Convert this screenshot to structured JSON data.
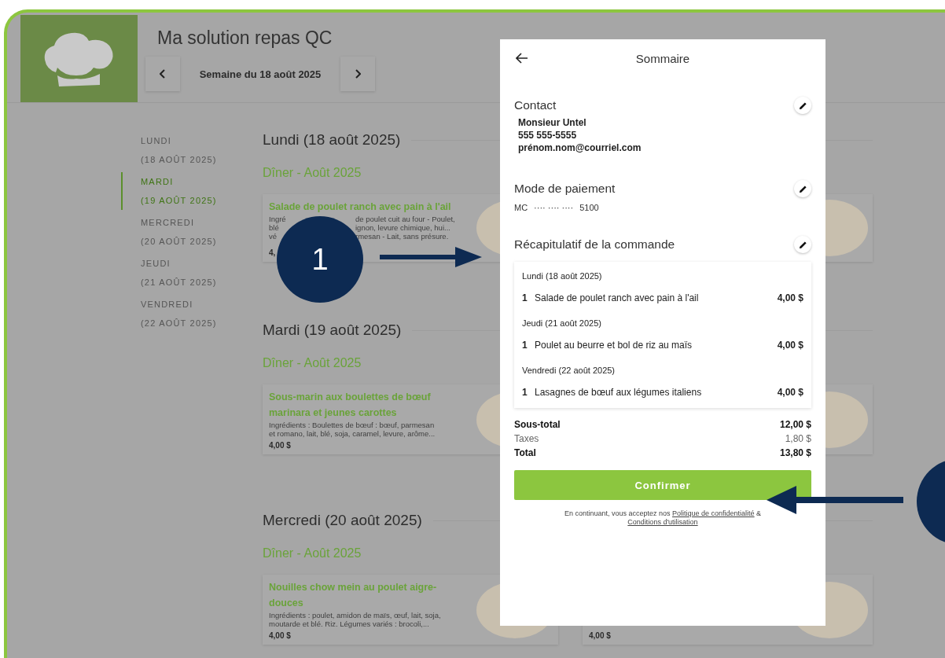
{
  "header": {
    "title": "Ma solution repas QC",
    "week_label": "Semaine du 18 août 2025"
  },
  "sidebar": {
    "items": [
      {
        "day": "LUNDI",
        "date": "(18 AOÛT 2025)",
        "selected": false
      },
      {
        "day": "MARDI",
        "date": "(19 AOÛT 2025)",
        "selected": true
      },
      {
        "day": "MERCREDI",
        "date": "(20 AOÛT 2025)",
        "selected": false
      },
      {
        "day": "JEUDI",
        "date": "(21 AOÛT 2025)",
        "selected": false
      },
      {
        "day": "VENDREDI",
        "date": "(22 AOÛT 2025)",
        "selected": false
      }
    ]
  },
  "days": [
    {
      "heading": "Lundi (18 août 2025)",
      "meal": "Dîner - Août 2025",
      "card": {
        "title": "Salade de poulet ranch avec pain à l'ail",
        "ingredient_lines": [
          [
            "Ingré",
            "de poulet cuit au four - Poulet,"
          ],
          [
            "blé",
            "ignon, levure chimique, hui..."
          ],
          [
            "vé",
            "rmesan - Lait, sans présure."
          ]
        ],
        "price": "4,"
      }
    },
    {
      "heading": "Mardi (19 août 2025)",
      "meal": "Dîner - Août 2025",
      "card": {
        "title": "Sous-marin aux boulettes de bœuf marinara et jeunes carottes",
        "ingredient_lines": [
          [
            "Ingrédients : Boulettes de bœuf : bœuf, parmesan"
          ],
          [
            "et romano, lait, blé, soja, caramel, levure, arôme..."
          ]
        ],
        "price": "4,00 $"
      }
    },
    {
      "heading": "Mercredi (20 août 2025)",
      "meal": "Dîner - Août 2025",
      "card": {
        "title": "Nouilles chow mein au poulet aigre-douces",
        "ingredient_lines": [
          [
            "Ingrédients : poulet, amidon de maïs, œuf, lait, soja,"
          ],
          [
            "moutarde et blé. Riz. Légumes variés : brocoli,..."
          ]
        ],
        "price": "4,00 $"
      },
      "side_card": {
        "price": "4,00 $"
      }
    }
  ],
  "summary": {
    "title": "Sommaire",
    "contact": {
      "heading": "Contact",
      "lines": [
        "Monsieur Untel",
        "555 555-5555",
        "prénom.nom@courriel.com"
      ]
    },
    "payment": {
      "heading": "Mode de paiement",
      "brand": "MC",
      "masked": "···· ···· ····",
      "last4": "5100"
    },
    "order": {
      "heading": "Récapitulatif de la commande",
      "groups": [
        {
          "day": "Lundi (18 août 2025)",
          "items": [
            {
              "qty": "1",
              "name": "Salade de poulet ranch avec pain à l'ail",
              "price": "4,00 $"
            }
          ]
        },
        {
          "day": "Jeudi (21 août 2025)",
          "items": [
            {
              "qty": "1",
              "name": "Poulet au beurre et bol de riz au maïs",
              "price": "4,00 $"
            }
          ]
        },
        {
          "day": "Vendredi (22 août 2025)",
          "items": [
            {
              "qty": "1",
              "name": "Lasagnes de bœuf aux légumes italiens",
              "price": "4,00 $"
            }
          ]
        }
      ]
    },
    "totals": [
      {
        "label": "Sous-total",
        "value": "12,00 $",
        "kind": "strong"
      },
      {
        "label": "Taxes",
        "value": "1,80 $",
        "kind": "muted"
      },
      {
        "label": "Total",
        "value": "13,80 $",
        "kind": "strong"
      }
    ],
    "confirm": "Confirmer",
    "legal": {
      "before": "En continuant, vous acceptez nos",
      "link1": "Politique de confidentialité",
      "between": "&",
      "link2": "Conditions d'utilisation"
    }
  },
  "callouts": [
    {
      "number": "1"
    }
  ]
}
